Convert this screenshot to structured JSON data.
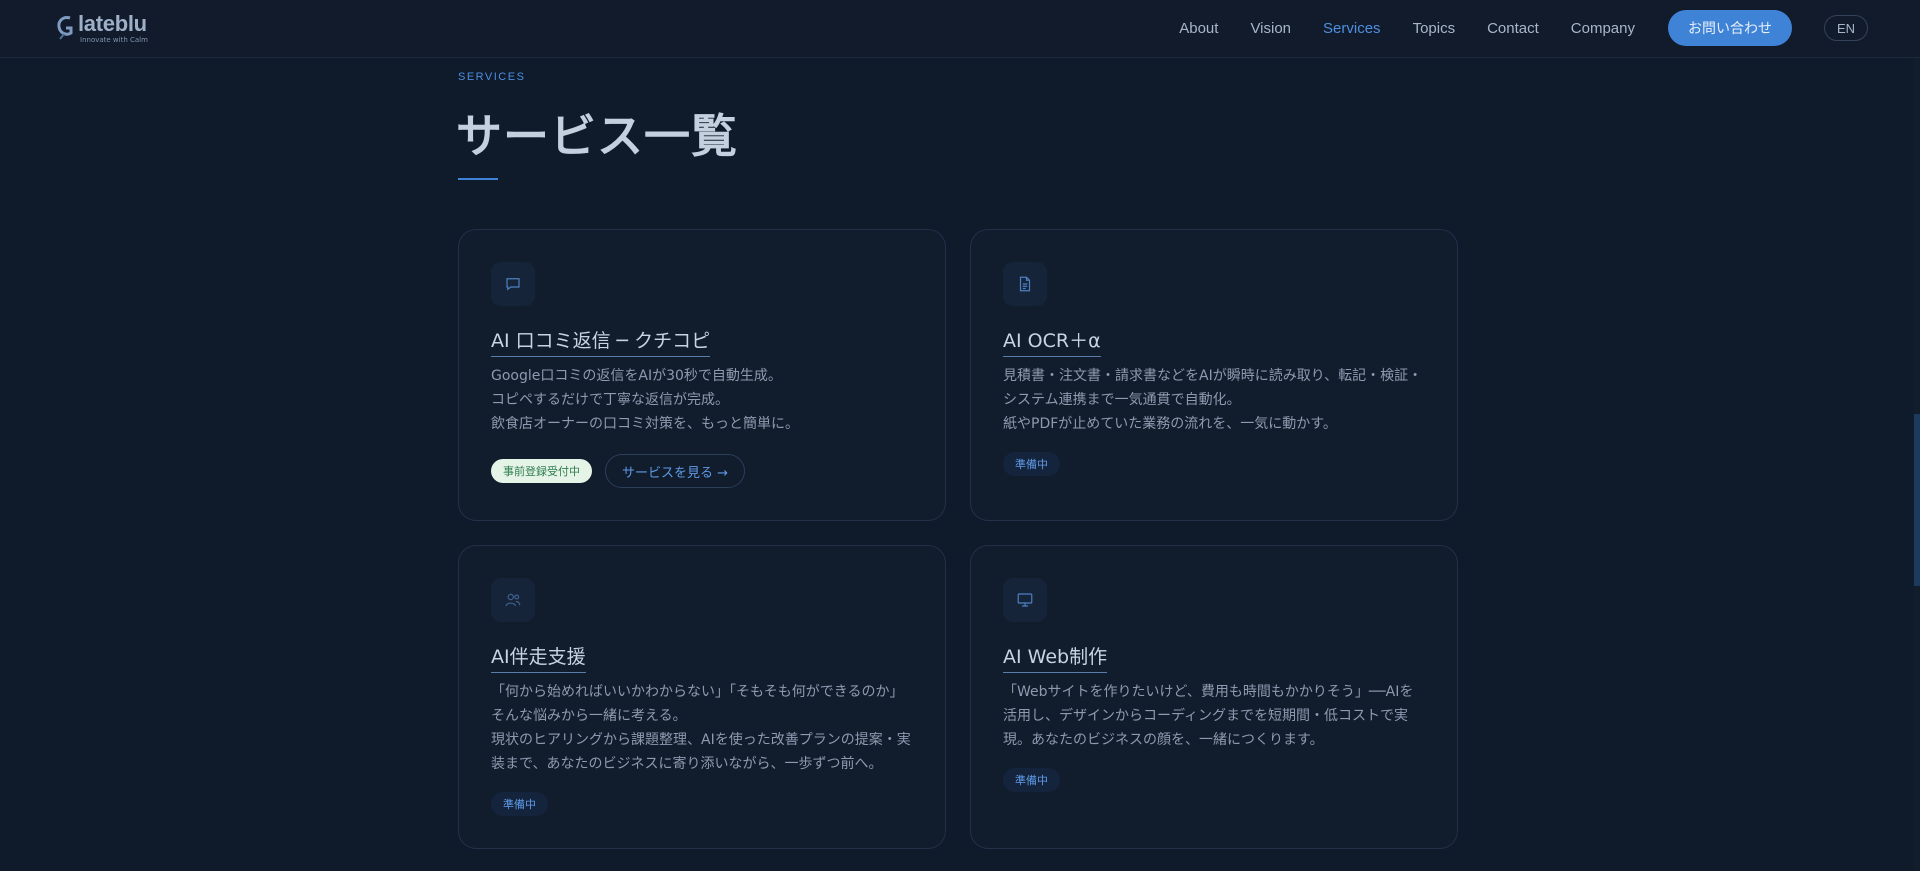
{
  "header": {
    "logo_name": "lateblu",
    "logo_tagline": "Innovate with Calm",
    "nav": [
      "About",
      "Vision",
      "Services",
      "Topics",
      "Contact",
      "Company"
    ],
    "active_nav": "Services",
    "contact_label": "お問い合わせ",
    "lang_label": "EN"
  },
  "section": {
    "eyebrow": "SERVICES",
    "title": "サービス一覧"
  },
  "cards": [
    {
      "icon": "chat-bubble-icon",
      "title": "AI 口コミ返信 ─ クチコピ",
      "desc": [
        "Google口コミの返信をAIが30秒で自動生成。",
        "コピペするだけで丁寧な返信が完成。",
        "飲食店オーナーの口コミ対策を、もっと簡単に。"
      ],
      "badge": "事前登録受付中",
      "link": "サービスを見る →"
    },
    {
      "icon": "document-icon",
      "title": "AI OCR＋α",
      "desc": [
        "見積書・注文書・請求書などをAIが瞬時に読み取り、転記・検証・",
        "システム連携まで一気通貫で自動化。",
        "紙やPDFが止めていた業務の流れを、一気に動かす。"
      ],
      "badge": "準備中"
    },
    {
      "icon": "users-icon",
      "title": "AI伴走支援",
      "desc": [
        "「何から始めればいいかわからない」「そもそも何ができるのか」",
        "そんな悩みから一緒に考える。",
        "現状のヒアリングから課題整理、AIを使った改善プランの提案・実",
        "装まで、あなたのビジネスに寄り添いながら、一歩ずつ前へ。"
      ],
      "badge": "準備中"
    },
    {
      "icon": "monitor-icon",
      "title": "AI Web制作",
      "desc": [
        "「Webサイトを作りたいけど、費用も時間もかかりそう」──AIを",
        "活用し、デザインからコーディングまでを短期間・低コストで実",
        "現。あなたのビジネスの顔を、一緒につくります。"
      ],
      "badge": "準備中"
    }
  ]
}
